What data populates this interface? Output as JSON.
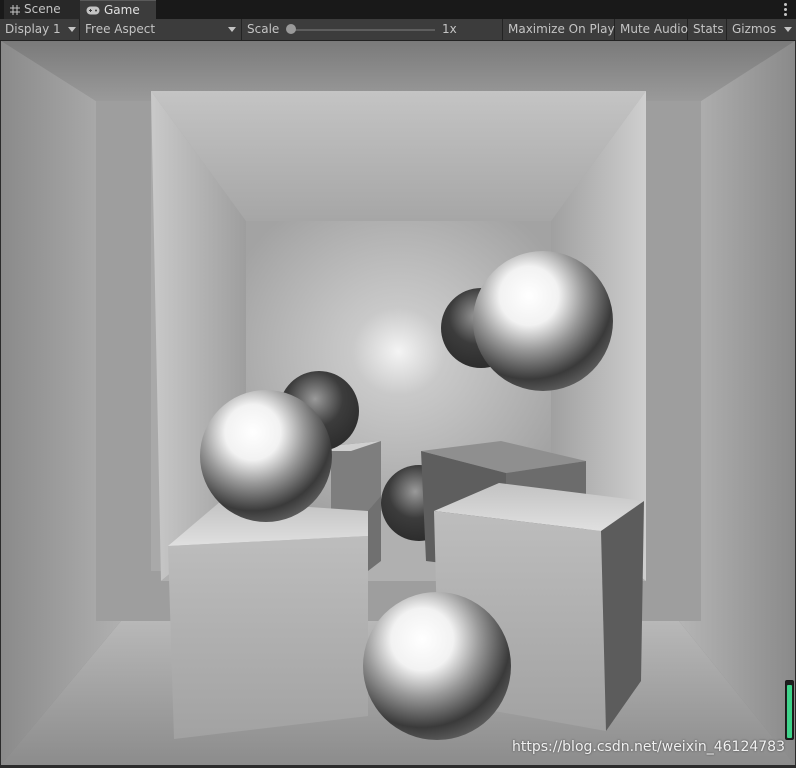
{
  "tabs": [
    {
      "label": "Scene",
      "icon": "grid-icon"
    },
    {
      "label": "Game",
      "icon": "gamepad-icon"
    }
  ],
  "toolbar": {
    "display": "Display 1",
    "aspect": "Free Aspect",
    "scale_label": "Scale",
    "scale_value": "1x",
    "maximize_on_play": "Maximize On Play",
    "mute_audio": "Mute Audio",
    "stats": "Stats",
    "gizmos": "Gizmos"
  },
  "viewport": {
    "watermark": "https://blog.csdn.net/weixin_46124783",
    "audio_level": 0.92,
    "accent_color": "#3fd38a"
  }
}
